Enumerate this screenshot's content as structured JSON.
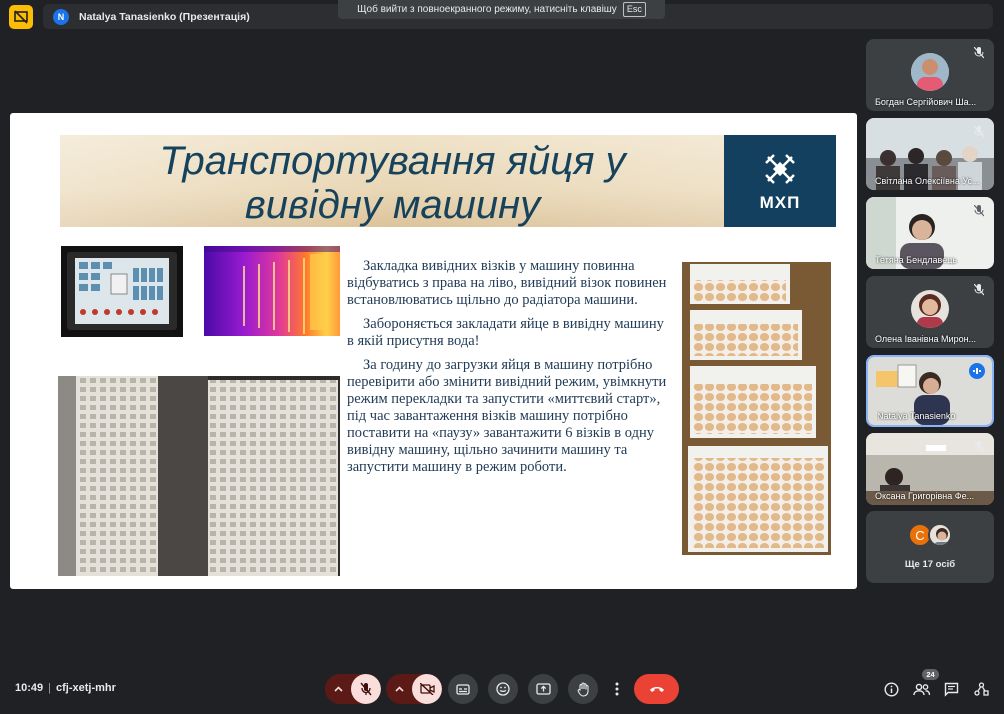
{
  "topbar": {
    "presenter_initial": "N",
    "presenting_label": "Natalya Tanasienko (Презентація)",
    "esc_tip": "Щоб вийти з повноекранного режиму, натисніть клавішу",
    "esc_key": "Esc"
  },
  "slide": {
    "title_line1": "Транспортування яйця у",
    "title_line2": "вивідну машину",
    "logo_text": "МХП",
    "paragraphs": [
      "Закладка вивідних візків у машину повинна відбуватись з права  на ліво, вивідний візок повинен встановлюватись щільно до радіатора машини.",
      "Забороняється закладати яйце в вивідну машину в якій присутня вода!",
      "За годину до загрузки яйця в машину потрібно перевірити або змінити вивідний режим, увімкнути режим перекладки та запустити «миттєвий старт», під час завантаження візків машину потрібно поставити на «паузу» завантажити 6 візків в одну вивідну машину, щільно зачинити машину та запустити машину в режим роботи."
    ]
  },
  "participants": [
    {
      "name": "Богдан Сергійович Ша...",
      "muted": true
    },
    {
      "name": "Світлана Олексіївна Ус...",
      "muted": true
    },
    {
      "name": "Тетяна Бендлавець",
      "muted": true
    },
    {
      "name": "Олена Іванівна Мирон...",
      "muted": true
    },
    {
      "name": "Natalya Tanasienko",
      "speaking": true
    },
    {
      "name": "Оксана Григорівна Фе...",
      "muted": true
    }
  ],
  "more_participants": {
    "initial": "С",
    "label": "Ще 17 осіб"
  },
  "bottombar": {
    "time": "10:49",
    "separator": "|",
    "meeting_code": "cfj-xetj-mhr",
    "people_count": "24"
  },
  "colors": {
    "background": "#202124",
    "hangup": "#ea4335",
    "slide_title": "#16425c",
    "logo_bg": "#13405e",
    "active_border": "#8ab4f8"
  }
}
